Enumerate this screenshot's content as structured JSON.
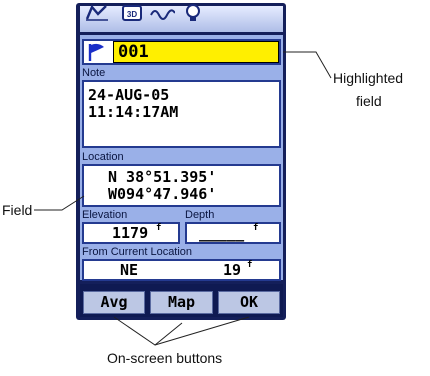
{
  "waypoint": {
    "name": "001",
    "note_label": "Note",
    "note_line1": "24-AUG-05",
    "note_line2": "11:14:17AM",
    "location_label": "Location",
    "lat": "N  38°51.395'",
    "lon": "W094°47.946'",
    "elevation_label": "Elevation",
    "elevation_value": "1179",
    "depth_label": "Depth",
    "depth_value": "_____",
    "from_label": "From Current Location",
    "bearing": "NE",
    "distance": "19",
    "unit_glyph": "f"
  },
  "buttons": {
    "avg": "Avg",
    "map": "Map",
    "ok": "OK"
  },
  "callouts": {
    "highlighted_line1": "Highlighted",
    "highlighted_line2": "field",
    "field": "Field",
    "buttons": "On-screen buttons"
  },
  "colors": {
    "frame": "#141f5a",
    "screen_bg": "#9ab0e8",
    "highlight": "#ffef00",
    "flag": "#1a2ec8",
    "button": "#bcc7e4"
  },
  "icons": [
    "waypoint-flag-icon",
    "track-icon",
    "3d-view-icon",
    "signal-icon",
    "bulb-icon"
  ]
}
